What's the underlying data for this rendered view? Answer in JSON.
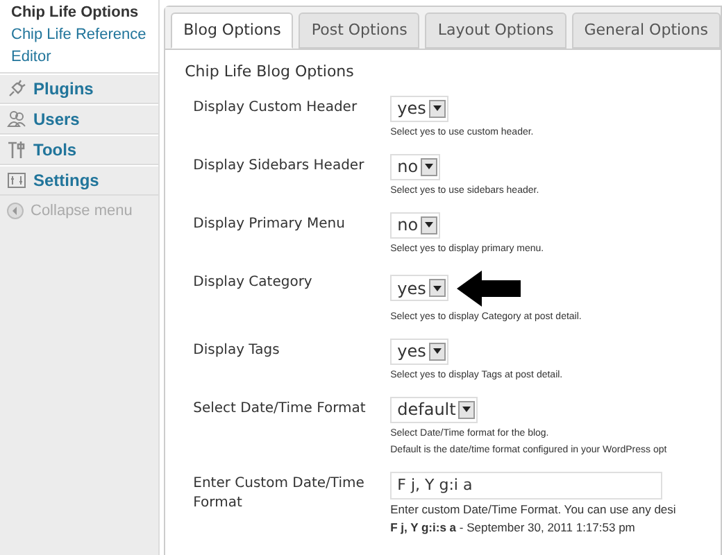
{
  "sidebar": {
    "submenu": [
      {
        "label": "Chip Life Options",
        "selected": true
      },
      {
        "label": "Chip Life Reference",
        "selected": false
      },
      {
        "label": "Editor",
        "selected": false
      }
    ],
    "menu": [
      {
        "label": "Plugins",
        "kind": "plugin"
      },
      {
        "label": "Users",
        "kind": "users"
      },
      {
        "label": "Tools",
        "kind": "tools"
      },
      {
        "label": "Settings",
        "kind": "settings"
      }
    ],
    "collapse": "Collapse menu"
  },
  "tabs": [
    {
      "label": "Blog Options",
      "selected": true
    },
    {
      "label": "Post Options",
      "selected": false
    },
    {
      "label": "Layout Options",
      "selected": false
    },
    {
      "label": "General Options",
      "selected": false
    }
  ],
  "section_title": "Chip Life Blog Options",
  "options": [
    {
      "kind": "select",
      "label": "Display Custom Header",
      "value": "yes",
      "help": [
        "Select yes to use custom header."
      ]
    },
    {
      "kind": "select",
      "label": "Display Sidebars Header",
      "value": "no",
      "help": [
        "Select yes to use sidebars header."
      ]
    },
    {
      "kind": "select",
      "label": "Display Primary Menu",
      "value": "no",
      "help": [
        "Select yes to display primary menu."
      ]
    },
    {
      "kind": "select",
      "label": "Display Category",
      "value": "yes",
      "pointer": true,
      "help": [
        "Select yes to display Category at post detail."
      ]
    },
    {
      "kind": "select",
      "label": "Display Tags",
      "value": "yes",
      "help": [
        "Select yes to display Tags at post detail."
      ]
    },
    {
      "kind": "select",
      "label": "Select Date/Time Format",
      "value": "default",
      "help": [
        "Select Date/Time format for the blog.",
        "Default is the date/time format configured in your WordPress opt"
      ]
    },
    {
      "kind": "text",
      "label": "Enter Custom Date/Time Format",
      "value": "F j, Y g:i a",
      "help": [
        "Enter custom Date/Time Format. You can use any desi",
        "**F j, Y g:i:s a** - September 30, 2011 1:17:53 pm"
      ]
    }
  ]
}
